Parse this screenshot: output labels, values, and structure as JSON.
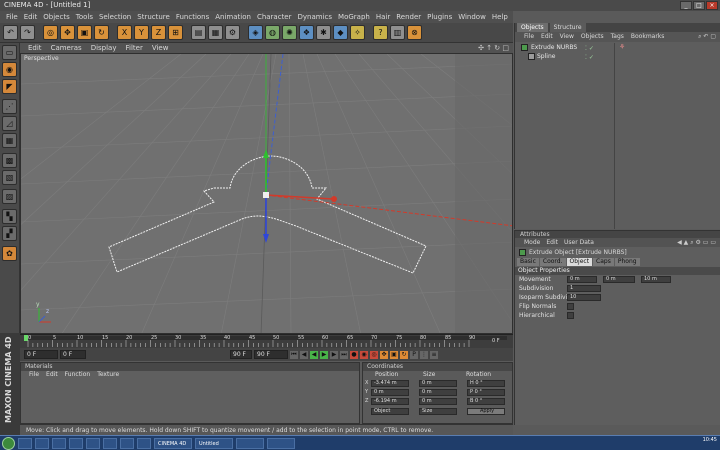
{
  "window": {
    "title": "CINEMA 4D - [Untitled 1]"
  },
  "menubar": [
    "File",
    "Edit",
    "Objects",
    "Tools",
    "Selection",
    "Structure",
    "Functions",
    "Animation",
    "Character",
    "Dynamics",
    "MoGraph",
    "Hair",
    "Render",
    "Plugins",
    "Window",
    "Help"
  ],
  "toolbar": {
    "icons": [
      "undo-icon",
      "redo-icon",
      "live-select-icon",
      "move-icon",
      "scale-icon",
      "rotate-icon",
      "x-axis-icon",
      "y-axis-icon",
      "z-axis-icon",
      "world-coords-icon",
      "render-view-icon",
      "render-picture-viewer-icon",
      "render-settings-icon",
      "cube-icon",
      "nurbs-icon",
      "array-icon",
      "deformer-icon",
      "scene-icon",
      "camera-icon",
      "light-icon",
      "help-icon",
      "layout-icon",
      "close-icon"
    ],
    "axis_x": "X",
    "axis_y": "Y",
    "axis_z": "Z"
  },
  "viewport": {
    "menu": [
      "Edit",
      "Cameras",
      "Display",
      "Filter",
      "View"
    ],
    "label": "Perspective",
    "nav_icons": "✣ ↑ ↻ □",
    "axis_y_letter": "y",
    "axis_z_letter": "z"
  },
  "timeline": {
    "ticks": [
      "0",
      "5",
      "10",
      "15",
      "20",
      "25",
      "30",
      "35",
      "40",
      "45",
      "50",
      "55",
      "60",
      "65",
      "70",
      "75",
      "80",
      "85",
      "90"
    ],
    "end_frame": "0 F",
    "start_field": "0 F",
    "current_field": "0 F",
    "end_field": "90 F",
    "end_field2": "90 F"
  },
  "materials": {
    "title": "Materials",
    "menu": [
      "File",
      "Edit",
      "Function",
      "Texture"
    ]
  },
  "coordinates": {
    "title": "Coordinates",
    "headers": [
      "Position",
      "Size",
      "Rotation"
    ],
    "rows": [
      {
        "axis": "X",
        "pos": "-3.474 m",
        "size": "0 m",
        "rot": "H  0 °"
      },
      {
        "axis": "Y",
        "pos": "0 m",
        "size": "0 m",
        "rot": "P  0 °"
      },
      {
        "axis": "Z",
        "pos": "-6.194 m",
        "size": "0 m",
        "rot": "B  0 °"
      }
    ],
    "mode1": "Object",
    "mode2": "Size",
    "apply": "Apply"
  },
  "objects": {
    "tabs": [
      "Objects",
      "Structure"
    ],
    "menu": [
      "File",
      "Edit",
      "View",
      "Objects",
      "Tags",
      "Bookmarks"
    ],
    "items": [
      {
        "name": "Extrude NURBS"
      },
      {
        "name": "Spline"
      }
    ]
  },
  "attributes": {
    "title": "Attributes",
    "menu": [
      "Mode",
      "Edit",
      "User Data"
    ],
    "object_label": "Extrude Object [Extrude NURBS]",
    "tabs": [
      "Basic",
      "Coord.",
      "Object",
      "Caps",
      "Phong"
    ],
    "section": "Object Properties",
    "movement_label": "Movement",
    "movement_x": "0 m",
    "movement_y": "0 m",
    "movement_z": "10 m",
    "subdivision_label": "Subdivision",
    "subdivision_val": "1",
    "iso_label": "Isoparm Subdivision",
    "iso_val": "10",
    "flip_label": "Flip Normals",
    "hier_label": "Hierarchical"
  },
  "status": "Move: Click and drag to move elements. Hold down SHIFT to quantize movement / add to the selection in point mode, CTRL to remove.",
  "maxon": "MAXON CINEMA 4D",
  "taskbar": {
    "tasks": [
      "",
      "",
      "",
      "",
      "",
      "",
      "",
      "",
      "CINEMA 4D",
      "Untitled",
      "",
      ""
    ],
    "time": "10:45"
  }
}
